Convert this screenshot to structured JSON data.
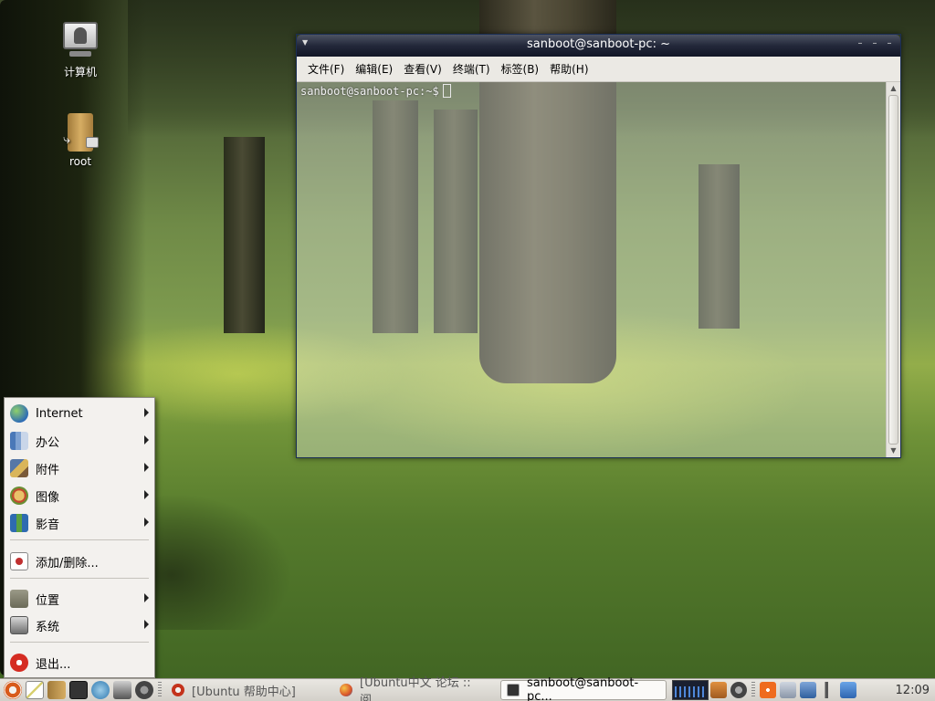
{
  "desktop": {
    "icons": [
      {
        "label": "计算机"
      },
      {
        "label": "root"
      }
    ]
  },
  "terminal": {
    "title": "sanboot@sanboot-pc: ~",
    "menus": [
      "文件(F)",
      "编辑(E)",
      "查看(V)",
      "终端(T)",
      "标签(B)",
      "帮助(H)"
    ],
    "prompt": "sanboot@sanboot-pc:~$"
  },
  "app_menu": {
    "items": [
      {
        "label": "Internet",
        "icon": "internet-icon",
        "submenu": true
      },
      {
        "label": "办公",
        "icon": "office-icon",
        "submenu": true
      },
      {
        "label": "附件",
        "icon": "accessories-icon",
        "submenu": true
      },
      {
        "label": "图像",
        "icon": "graphics-icon",
        "submenu": true
      },
      {
        "label": "影音",
        "icon": "multimedia-icon",
        "submenu": true
      },
      {
        "label": "添加/删除...",
        "icon": "add-remove-icon",
        "submenu": false
      },
      {
        "label": "位置",
        "icon": "places-icon",
        "submenu": true
      },
      {
        "label": "系统",
        "icon": "system-icon",
        "submenu": true
      },
      {
        "label": "退出...",
        "icon": "logout-icon",
        "submenu": false
      }
    ]
  },
  "taskbar": {
    "tasks": [
      {
        "label": "[Ubuntu 帮助中心]",
        "icon": "help-icon"
      },
      {
        "label": "[Ubuntu中文 论坛 :: 阅...",
        "icon": "firefox-icon"
      },
      {
        "label": "sanboot@sanboot-pc...",
        "icon": "terminal-icon"
      }
    ],
    "clock": "12:09"
  },
  "colors": {
    "panel": "#e0ded8",
    "title_bar": "#23283a",
    "menu_bg": "#f3f1ee",
    "ubuntu_orange": "#d85b1c"
  }
}
